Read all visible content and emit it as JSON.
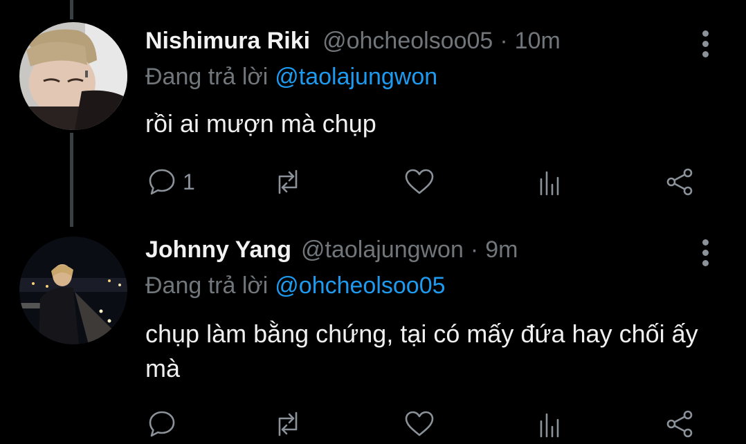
{
  "tweets": [
    {
      "name": "Nishimura Riki",
      "handle": "@ohcheolsoo05",
      "separator": "·",
      "time": "10m",
      "reply_prefix": "Đang trả lời",
      "reply_to": "@taolajungwon",
      "text": "rồi ai mượn mà chụp",
      "reply_count": "1"
    },
    {
      "name": "Johnny Yang",
      "handle": "@taolajungwon",
      "separator": "·",
      "time": "9m",
      "reply_prefix": "Đang trả lời",
      "reply_to": "@ohcheolsoo05",
      "text": "chụp làm bằng chứng, tại có mấy đứa hay chối ấy mà",
      "reply_count": ""
    }
  ],
  "colors": {
    "background": "#000000",
    "text": "#e7e9ea",
    "secondary": "#71767b",
    "accent": "#1d9bf0",
    "thread_line": "#3a3f44"
  },
  "icons": [
    "reply-icon",
    "retweet-icon",
    "like-icon",
    "stats-icon",
    "share-icon",
    "more-icon"
  ]
}
